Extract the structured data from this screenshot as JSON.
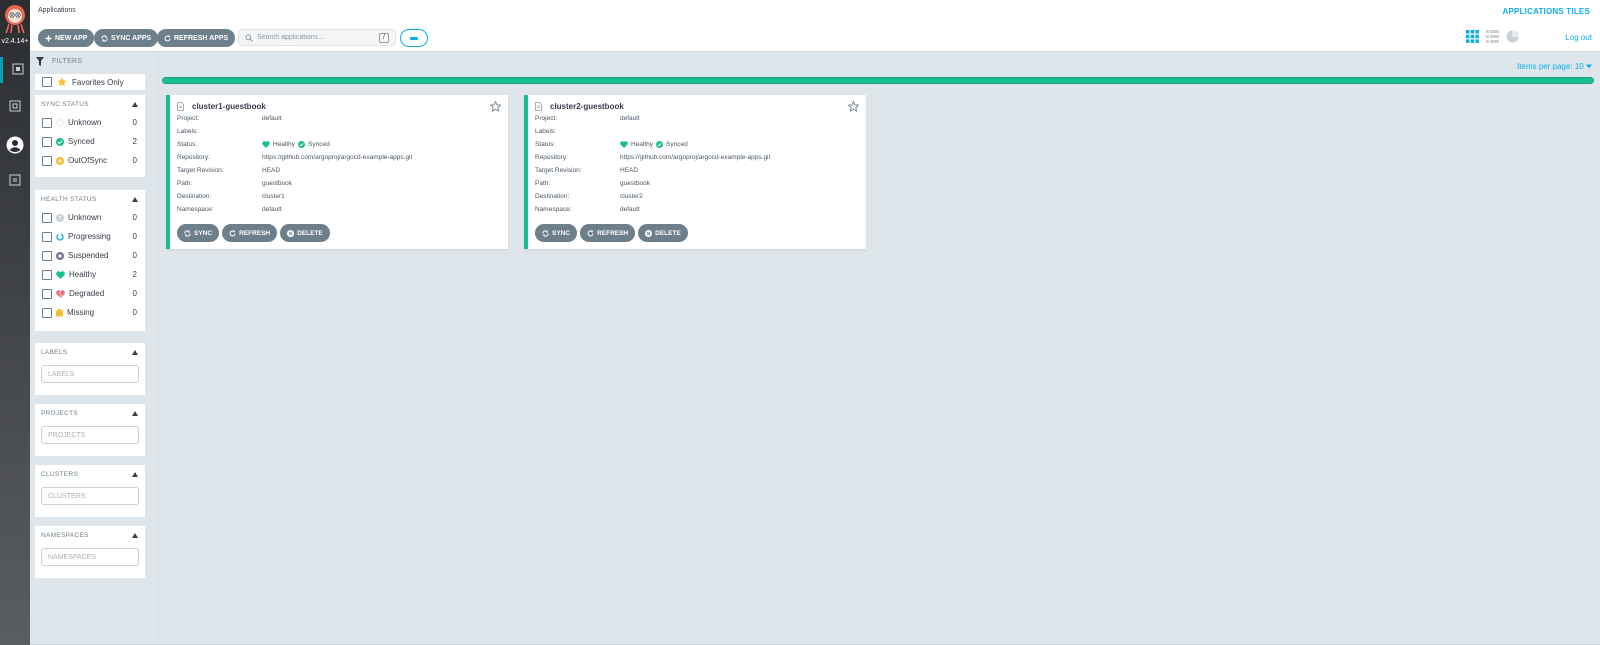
{
  "nav": {
    "version": "v2.4.14+",
    "items": [
      {
        "name": "applications"
      },
      {
        "name": "settings"
      },
      {
        "name": "user-info"
      },
      {
        "name": "documentation"
      }
    ]
  },
  "header": {
    "title": "Applications",
    "view_title": "APPLICATIONS TILES",
    "logout": "Log out"
  },
  "toolbar": {
    "new_app": "NEW APP",
    "sync_apps": "SYNC APPS",
    "refresh_apps": "REFRESH APPS",
    "search_placeholder": "Search applications...",
    "search_shortcut": "/"
  },
  "filters": {
    "heading": "FILTERS",
    "favorites_only": "Favorites Only",
    "sync_status": {
      "title": "SYNC STATUS",
      "items": [
        {
          "label": "Unknown",
          "count": "0",
          "color": "#c9d1d7"
        },
        {
          "label": "Synced",
          "count": "2",
          "color": "#18be94"
        },
        {
          "label": "OutOfSync",
          "count": "0",
          "color": "#f4c030"
        }
      ]
    },
    "health_status": {
      "title": "HEALTH STATUS",
      "items": [
        {
          "label": "Unknown",
          "count": "0",
          "color": "#c9d1d7"
        },
        {
          "label": "Progressing",
          "count": "0",
          "color": "#0dadea"
        },
        {
          "label": "Suspended",
          "count": "0",
          "color": "#766f94"
        },
        {
          "label": "Healthy",
          "count": "2",
          "color": "#18be94"
        },
        {
          "label": "Degraded",
          "count": "0",
          "color": "#e96d76"
        },
        {
          "label": "Missing",
          "count": "0",
          "color": "#f4c030"
        }
      ]
    },
    "labels": {
      "title": "LABELS",
      "placeholder": "LABELS"
    },
    "projects": {
      "title": "PROJECTS",
      "placeholder": "PROJECTS"
    },
    "clusters": {
      "title": "CLUSTERS",
      "placeholder": "CLUSTERS"
    },
    "namespaces": {
      "title": "NAMESPACES",
      "placeholder": "NAMESPACES"
    }
  },
  "main": {
    "items_per_page": "Items per page: 10",
    "sync_progress_fraction": 1.0,
    "field_labels": {
      "project": "Project:",
      "labels": "Labels:",
      "status": "Status:",
      "repository": "Repository:",
      "target_revision": "Target Revision:",
      "path": "Path:",
      "destination": "Destination:",
      "namespace": "Namespace:"
    },
    "actions": {
      "sync": "SYNC",
      "refresh": "REFRESH",
      "delete": "DELETE"
    },
    "apps": [
      {
        "name": "cluster1-guestbook",
        "project": "default",
        "labels": "",
        "health": "Healthy",
        "sync": "Synced",
        "repository": "https://github.com/argoproj/argocd-example-apps.git",
        "target_revision": "HEAD",
        "path": "guestbook",
        "destination": "cluster1",
        "namespace": "default"
      },
      {
        "name": "cluster2-guestbook",
        "project": "default",
        "labels": "",
        "health": "Healthy",
        "sync": "Synced",
        "repository": "https://github.com/argoproj/argocd-example-apps.git",
        "target_revision": "HEAD",
        "path": "guestbook",
        "destination": "cluster2",
        "namespace": "default"
      }
    ]
  },
  "colors": {
    "accent": "#0dadea",
    "healthy": "#18be94",
    "button": "#6d7f8b"
  }
}
